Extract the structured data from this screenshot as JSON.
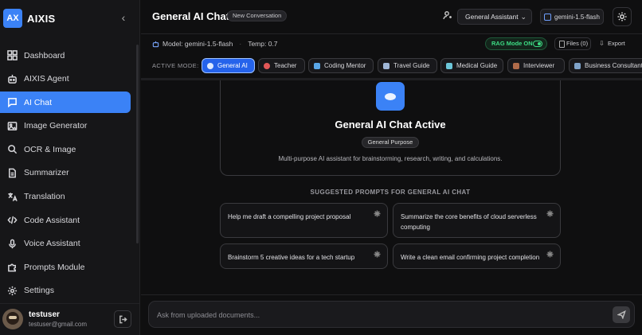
{
  "brand": {
    "logo": "AX",
    "name": "AIXIS"
  },
  "sidebar": {
    "items": [
      {
        "label": "Dashboard",
        "icon": "dashboard-icon"
      },
      {
        "label": "AIXIS Agent",
        "icon": "robot-icon"
      },
      {
        "label": "AI Chat",
        "icon": "chat-icon",
        "active": true
      },
      {
        "label": "Image Generator",
        "icon": "image-icon"
      },
      {
        "label": "OCR & Image",
        "icon": "search-icon"
      },
      {
        "label": "Summarizer",
        "icon": "document-icon"
      },
      {
        "label": "Translation",
        "icon": "translate-icon"
      },
      {
        "label": "Code Assistant",
        "icon": "code-icon"
      },
      {
        "label": "Voice Assistant",
        "icon": "microphone-icon"
      },
      {
        "label": "Prompts Module",
        "icon": "puzzle-icon"
      },
      {
        "label": "Settings",
        "icon": "gear-icon"
      }
    ]
  },
  "user": {
    "name": "testuser",
    "email": "testuser@gmail.com"
  },
  "header": {
    "title": "General AI Chat",
    "conversation_badge": "New Conversation",
    "assistant_select": "General Assistant",
    "model_pill": "gemini-1.5-flash"
  },
  "subheader": {
    "model": "Model: gemini-1.5-flash",
    "temp": "Temp: 0.7",
    "rag": "RAG Mode ON",
    "files": "Files (0)",
    "export": "Export"
  },
  "modes": {
    "label": "ACTIVE MODE:",
    "chips": [
      {
        "label": "General AI",
        "active": true
      },
      {
        "label": "Teacher"
      },
      {
        "label": "Coding Mentor"
      },
      {
        "label": "Travel Guide"
      },
      {
        "label": "Medical Guide"
      },
      {
        "label": "Interviewer"
      },
      {
        "label": "Business Consultant"
      }
    ]
  },
  "hero": {
    "title": "General AI Chat Active",
    "badge": "General Purpose",
    "description": "Multi-purpose AI assistant for brainstorming, research, writing, and calculations."
  },
  "suggestions": {
    "heading": "SUGGESTED PROMPTS FOR GENERAL AI CHAT",
    "prompts": [
      "Help me draft a compelling project proposal",
      "Summarize the core benefits of cloud serverless computing",
      "Brainstorm 5 creative ideas for a tech startup",
      "Write a clean email confirming project completion"
    ]
  },
  "composer": {
    "placeholder": "Ask from uploaded documents..."
  },
  "colors": {
    "accent": "#3b82f6",
    "rag_green": "#3ddc84",
    "background": "#0f0f10"
  }
}
